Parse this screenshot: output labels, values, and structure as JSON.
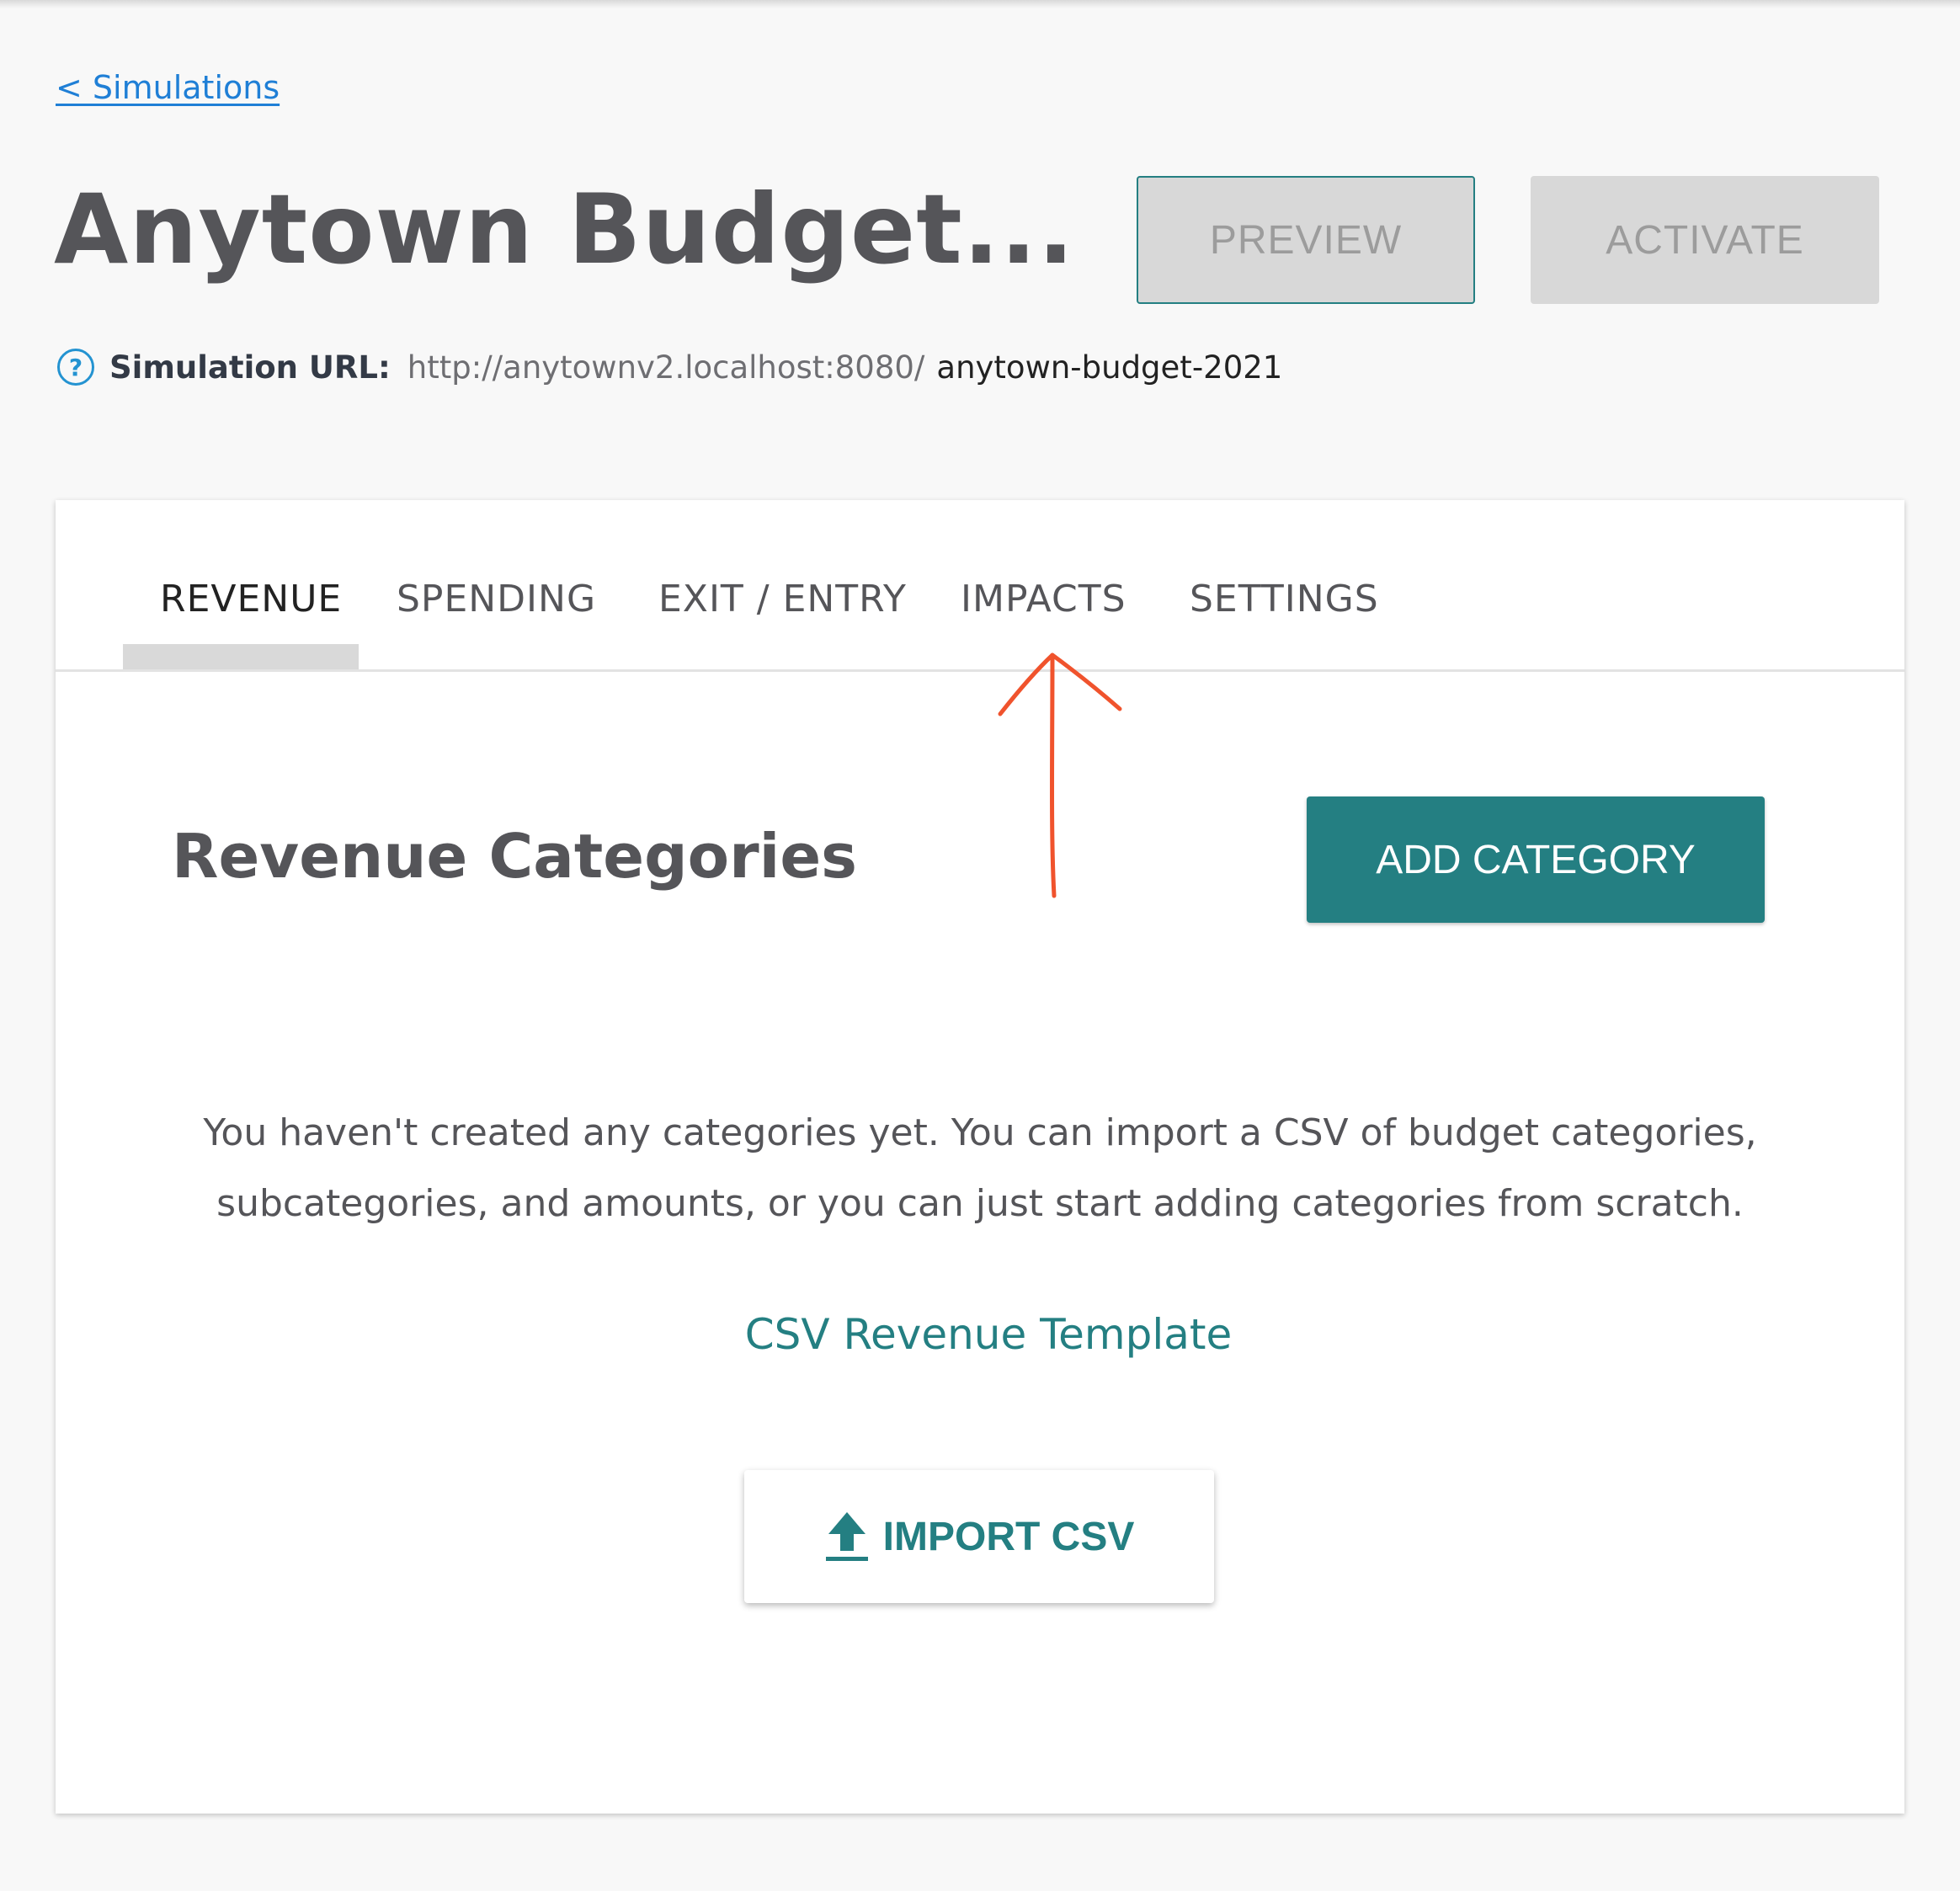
{
  "header": {
    "back_link": "< Simulations",
    "title": "Anytown Budget...",
    "preview_label": "PREVIEW",
    "activate_label": "ACTIVATE"
  },
  "simulation_url": {
    "label": "Simulation URL:",
    "base": "http://anytownv2.localhost:8080/",
    "slug": "anytown-budget-2021"
  },
  "tabs": [
    {
      "label": "REVENUE",
      "active": true
    },
    {
      "label": "SPENDING",
      "active": false
    },
    {
      "label": "EXIT / ENTRY",
      "active": false
    },
    {
      "label": "IMPACTS",
      "active": false
    },
    {
      "label": "SETTINGS",
      "active": false
    }
  ],
  "revenue": {
    "section_title": "Revenue Categories",
    "add_category_label": "ADD CATEGORY",
    "empty_message": "You haven't created any categories yet. You can import a CSV of budget categories, subcategories, and amounts, or you can just start adding categories from scratch.",
    "template_link": "CSV Revenue Template",
    "import_label": "IMPORT CSV"
  },
  "icons": {
    "help": "help-circle-icon",
    "download": "download-icon",
    "upload": "upload-icon"
  },
  "colors": {
    "accent": "#247f82",
    "link": "#1f7fd6",
    "help_icon": "#2493d1",
    "annotation": "#f0532d",
    "disabled_button": "#d8d8d8"
  }
}
